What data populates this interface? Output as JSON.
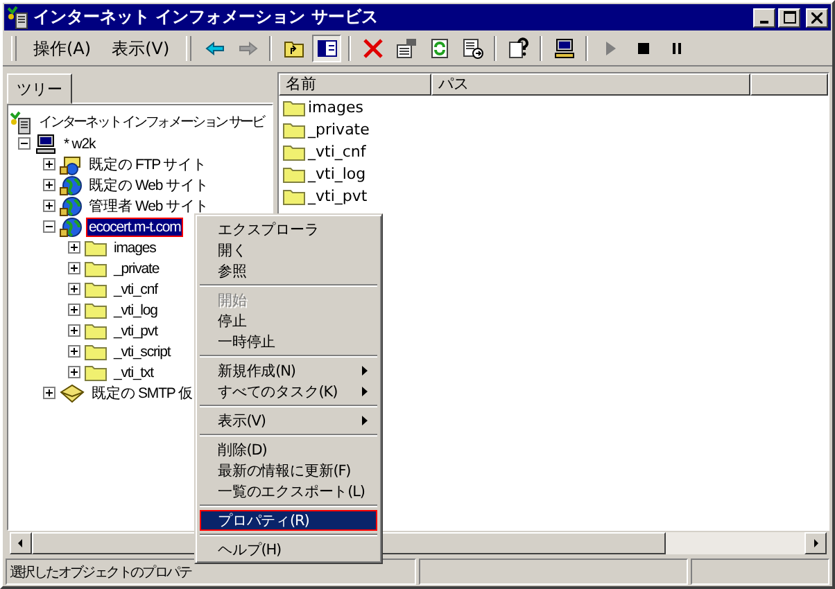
{
  "window": {
    "title": "インターネット インフォメーション サービス"
  },
  "menu": [
    {
      "label": "操作(A)"
    },
    {
      "label": "表示(V)"
    }
  ],
  "tree_tab": {
    "label": "ツリー",
    "selected": true
  },
  "tree": {
    "label": "インターネット インフォメーション サービ",
    "kind": "iis",
    "children": [
      {
        "label": "* w2k",
        "kind": "computer",
        "expanded": true,
        "selected": false,
        "highlighted": false,
        "children": [
          {
            "label": "既定の FTP サイト",
            "kind": "ftp",
            "expanded": false,
            "selected": false,
            "highlighted": false
          },
          {
            "label": "既定の Web サイト",
            "kind": "web",
            "expanded": false,
            "selected": false,
            "highlighted": false
          },
          {
            "label": "管理者 Web サイト",
            "kind": "web",
            "expanded": false,
            "selected": false,
            "highlighted": false
          },
          {
            "label": "ecocert.m-t.com",
            "kind": "web",
            "expanded": true,
            "selected": true,
            "highlighted": true,
            "children": [
              {
                "label": "images",
                "kind": "folder",
                "expanded": false,
                "selected": false,
                "highlighted": false
              },
              {
                "label": "_private",
                "kind": "folder",
                "expanded": false,
                "selected": false,
                "highlighted": false
              },
              {
                "label": "_vti_cnf",
                "kind": "folder",
                "expanded": false,
                "selected": false,
                "highlighted": false
              },
              {
                "label": "_vti_log",
                "kind": "folder",
                "expanded": false,
                "selected": false,
                "highlighted": false
              },
              {
                "label": "_vti_pvt",
                "kind": "folder",
                "expanded": false,
                "selected": false,
                "highlighted": false
              },
              {
                "label": "_vti_script",
                "kind": "folder",
                "expanded": false,
                "selected": false,
                "highlighted": false
              },
              {
                "label": "_vti_txt",
                "kind": "folder",
                "expanded": false,
                "selected": false,
                "highlighted": false
              }
            ]
          },
          {
            "label": "既定の SMTP 仮",
            "kind": "smtp",
            "expanded": false,
            "selected": false,
            "highlighted": false
          }
        ]
      }
    ]
  },
  "list": {
    "columns": [
      "名前",
      "パス"
    ],
    "rows": [
      {
        "name": "images"
      },
      {
        "name": "_private"
      },
      {
        "name": "_vti_cnf"
      },
      {
        "name": "_vti_log"
      },
      {
        "name": "_vti_pvt"
      }
    ]
  },
  "context_menu": {
    "groups": [
      [
        {
          "label": "エクスプローラ",
          "disabled": false,
          "submenu": false,
          "selected": false,
          "highlighted": false
        },
        {
          "label": "開く",
          "disabled": false,
          "submenu": false,
          "selected": false,
          "highlighted": false
        },
        {
          "label": "参照",
          "disabled": false,
          "submenu": false,
          "selected": false,
          "highlighted": false
        }
      ],
      [
        {
          "label": "開始",
          "disabled": true,
          "submenu": false,
          "selected": false,
          "highlighted": false
        },
        {
          "label": "停止",
          "disabled": false,
          "submenu": false,
          "selected": false,
          "highlighted": false
        },
        {
          "label": "一時停止",
          "disabled": false,
          "submenu": false,
          "selected": false,
          "highlighted": false
        }
      ],
      [
        {
          "label": "新規作成(N)",
          "disabled": false,
          "submenu": true,
          "selected": false,
          "highlighted": false
        },
        {
          "label": "すべてのタスク(K)",
          "disabled": false,
          "submenu": true,
          "selected": false,
          "highlighted": false
        }
      ],
      [
        {
          "label": "表示(V)",
          "disabled": false,
          "submenu": true,
          "selected": false,
          "highlighted": false
        }
      ],
      [
        {
          "label": "削除(D)",
          "disabled": false,
          "submenu": false,
          "selected": false,
          "highlighted": false
        },
        {
          "label": "最新の情報に更新(F)",
          "disabled": false,
          "submenu": false,
          "selected": false,
          "highlighted": false
        },
        {
          "label": "一覧のエクスポート(L)",
          "disabled": false,
          "submenu": false,
          "selected": false,
          "highlighted": false
        }
      ],
      [
        {
          "label": "プロパティ(R)",
          "disabled": false,
          "submenu": false,
          "selected": true,
          "highlighted": true
        }
      ],
      [
        {
          "label": "ヘルプ(H)",
          "disabled": false,
          "submenu": false,
          "selected": false,
          "highlighted": false
        }
      ]
    ]
  },
  "status_bar": {
    "text": "選択したオブジェクトのプロパテ"
  }
}
